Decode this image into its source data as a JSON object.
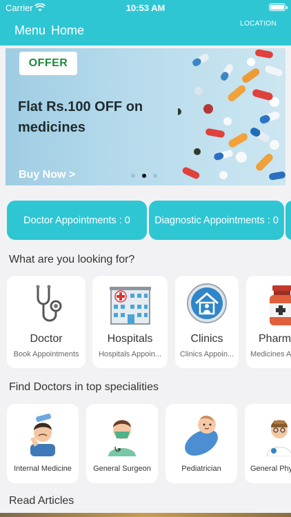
{
  "status_bar": {
    "carrier": "Carrier",
    "time": "10:53 AM"
  },
  "nav": {
    "menu_label": "Menu",
    "title": "Home",
    "location_label": "LOCATION"
  },
  "banner": {
    "badge": "OFFER",
    "headline": "Flat Rs.100 OFF on medicines",
    "cta": "Buy Now >",
    "slides": 3,
    "active_slide": 2
  },
  "appointments": {
    "doctor": "Doctor Appointments : 0",
    "diagnostic": "Diagnostic Appointments : 0"
  },
  "services": {
    "heading": "What are you looking for?",
    "items": [
      {
        "name": "Doctor",
        "sub": "Book Appointments",
        "icon": "stethoscope-icon"
      },
      {
        "name": "Hospitals",
        "sub": "Hospitals Appoin...",
        "icon": "hospital-icon"
      },
      {
        "name": "Clinics",
        "sub": "Clinics Appoin...",
        "icon": "clinic-icon"
      },
      {
        "name": "Pharm",
        "sub": "Medicines A",
        "icon": "medicine-bottle-icon"
      }
    ]
  },
  "specialities": {
    "heading": "Find Doctors in top specialities",
    "items": [
      {
        "name": "Internal Medicine",
        "icon": "sick-person-icon"
      },
      {
        "name": "General Surgeon",
        "icon": "surgeon-icon"
      },
      {
        "name": "Pediatrician",
        "icon": "baby-icon"
      },
      {
        "name": "General Phy",
        "icon": "doctor-icon"
      }
    ]
  },
  "articles": {
    "heading": "Read Articles"
  },
  "colors": {
    "primary": "#2fc6d3",
    "offer_green": "#1f8a3c"
  }
}
